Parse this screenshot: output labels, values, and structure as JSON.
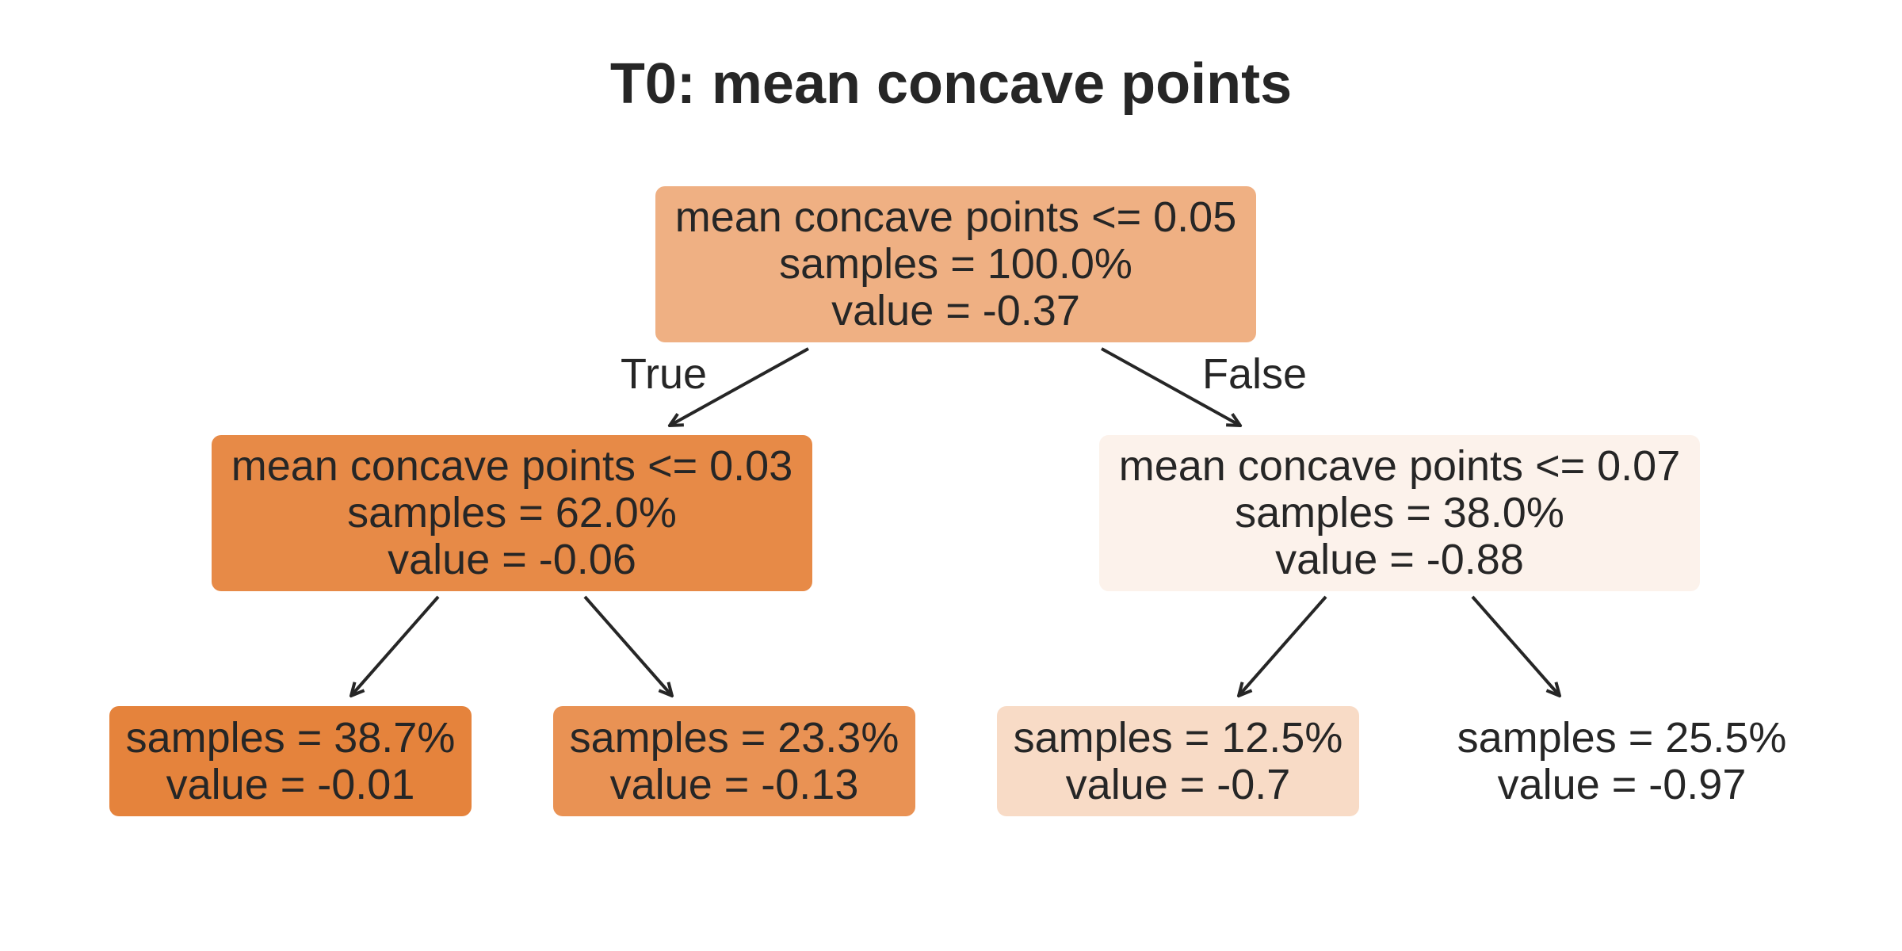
{
  "title": "T0: mean concave points",
  "nodes": {
    "root": {
      "condition": "mean concave points <= 0.05",
      "samples": "samples = 100.0%",
      "value": "value = -0.37",
      "color": "#efb083"
    },
    "left": {
      "condition": "mean concave points <= 0.03",
      "samples": "samples = 62.0%",
      "value": "value = -0.06",
      "color": "#e78a47"
    },
    "right": {
      "condition": "mean concave points <= 0.07",
      "samples": "samples = 38.0%",
      "value": "value = -0.88",
      "color": "#fcf2eb"
    },
    "ll": {
      "samples": "samples = 38.7%",
      "value": "value = -0.01",
      "color": "#e5833c"
    },
    "lr": {
      "samples": "samples = 23.3%",
      "value": "value = -0.13",
      "color": "#e99254"
    },
    "rl": {
      "samples": "samples = 12.5%",
      "value": "value = -0.7",
      "color": "#f8dbc6"
    },
    "rr": {
      "samples": "samples = 25.5%",
      "value": "value = -0.97",
      "color": "#ffffff"
    }
  },
  "edge_labels": {
    "true": "True",
    "false": "False"
  }
}
